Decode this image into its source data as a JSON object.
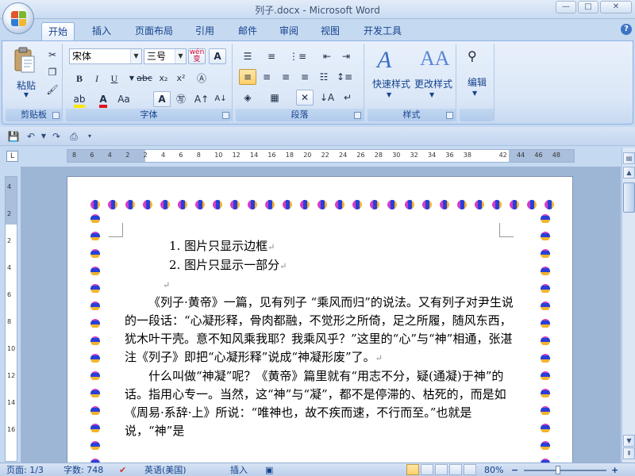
{
  "window": {
    "title": "列子.docx - Microsoft Word",
    "minimize": "—",
    "maximize": "□",
    "close": "✕"
  },
  "tabs": [
    "开始",
    "插入",
    "页面布局",
    "引用",
    "邮件",
    "审阅",
    "视图",
    "开发工具"
  ],
  "ribbon": {
    "clipboard": {
      "label": "剪贴板",
      "paste": "粘贴"
    },
    "font": {
      "label": "字体",
      "font_name": "宋体",
      "font_size": "三号",
      "wen": "wén\n变",
      "A": "A"
    },
    "paragraph": {
      "label": "段落"
    },
    "styles": {
      "label": "样式",
      "quick_styles": "快速样式",
      "change_styles": "更改样式"
    },
    "editing": {
      "label": "编辑",
      "edit": "编辑"
    }
  },
  "ruler": {
    "h_ticks": [
      "8",
      "6",
      "4",
      "2",
      "2",
      "4",
      "6",
      "8",
      "10",
      "12",
      "14",
      "16",
      "18",
      "20",
      "22",
      "24",
      "26",
      "28",
      "30",
      "32",
      "34",
      "36",
      "38",
      "42",
      "44",
      "46",
      "48"
    ],
    "v_ticks": [
      "4",
      "2",
      "2",
      "4",
      "6",
      "8",
      "10",
      "12",
      "14",
      "16"
    ]
  },
  "document": {
    "list": [
      "1. 图片只显示边框",
      "2. 图片只显示一部分"
    ],
    "paragraph_mark": "↵",
    "paragraphs": [
      "《列子·黄帝》一篇，见有列子 “乘风而归”的说法。又有列子对尹生说的一段话：“心凝形释，骨肉都融，不觉形之所倚，足之所履，随风东西，犹木叶干壳。意不知风乘我耶？我乘风乎？”这里的“心”与“神”相通，张湛注《列子》即把“心凝形释”说成“神凝形废”了。",
      "什么叫做“神凝”呢？《黄帝》篇里就有“用志不分，疑(通凝)于神”的话。指用心专一。当然，这“神”与“凝”，都不是停滞的、枯死的，而是如《周易·系辞·上》所说：“唯神也，故不疾而速，不行而至。”也就是说，“神”是"
    ]
  },
  "status": {
    "page": "页面: 1/3",
    "words": "字数: 748",
    "language": "英语(美国)",
    "mode": "插入",
    "zoom": "80%",
    "zoom_minus": "−",
    "zoom_plus": "+"
  },
  "colors": {
    "ribbon_bg": "#dbe7f7",
    "accent": "#15428b",
    "border_pink": "#d33ec6",
    "border_blue": "#2a3fd8",
    "border_gold": "#f2b430"
  }
}
